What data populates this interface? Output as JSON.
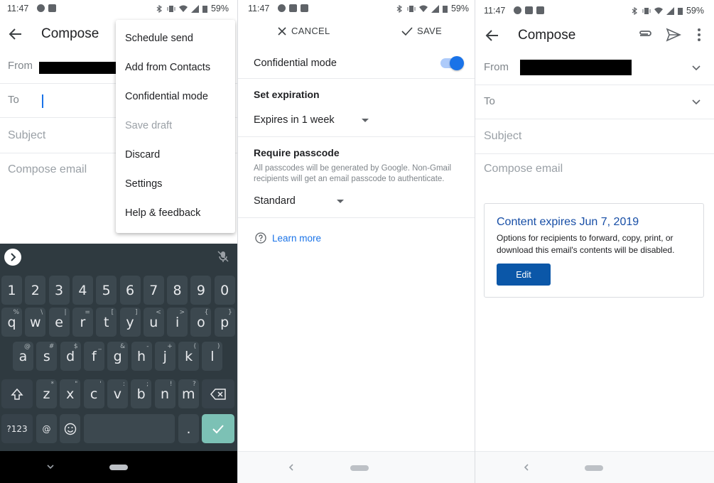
{
  "status": {
    "p1": {
      "time": "11:47",
      "battery": "59%"
    },
    "p2": {
      "time": "11:47",
      "battery": "59%"
    },
    "p3": {
      "time": "11:47",
      "battery": "59%"
    }
  },
  "compose_menu_screen": {
    "title": "Compose",
    "from_label": "From",
    "to_label": "To",
    "subject_placeholder": "Subject",
    "body_placeholder": "Compose email",
    "menu_items": [
      "Schedule send",
      "Add from Contacts",
      "Confidential mode",
      "Save draft",
      "Discard",
      "Settings",
      "Help & feedback"
    ],
    "disabled_menu_item": "Save draft",
    "keyboard": {
      "number_row": [
        "1",
        "2",
        "3",
        "4",
        "5",
        "6",
        "7",
        "8",
        "9",
        "0"
      ],
      "row1": [
        {
          "k": "q",
          "h": "%"
        },
        {
          "k": "w",
          "h": "\\"
        },
        {
          "k": "e",
          "h": "|"
        },
        {
          "k": "r",
          "h": "="
        },
        {
          "k": "t",
          "h": "["
        },
        {
          "k": "y",
          "h": "]"
        },
        {
          "k": "u",
          "h": "<"
        },
        {
          "k": "i",
          "h": ">"
        },
        {
          "k": "o",
          "h": "{"
        },
        {
          "k": "p",
          "h": "}"
        }
      ],
      "row2": [
        {
          "k": "a",
          "h": "@"
        },
        {
          "k": "s",
          "h": "#"
        },
        {
          "k": "d",
          "h": "$"
        },
        {
          "k": "f",
          "h": "_"
        },
        {
          "k": "g",
          "h": "&"
        },
        {
          "k": "h",
          "h": "-"
        },
        {
          "k": "j",
          "h": "+"
        },
        {
          "k": "k",
          "h": "("
        },
        {
          "k": "l",
          "h": ")"
        }
      ],
      "row3": [
        {
          "k": "z",
          "h": "*"
        },
        {
          "k": "x",
          "h": "\""
        },
        {
          "k": "c",
          "h": "'"
        },
        {
          "k": "v",
          "h": ":"
        },
        {
          "k": "b",
          "h": ";"
        },
        {
          "k": "n",
          "h": "!"
        },
        {
          "k": "m",
          "h": "?"
        }
      ],
      "symbols_key": "?123",
      "at_key": "@",
      "period_key": ".",
      "enter_color": "#7cc1b5"
    }
  },
  "confidential_screen": {
    "cancel_label": "CANCEL",
    "save_label": "SAVE",
    "confidential_label": "Confidential mode",
    "toggle_on": true,
    "set_expiration_heading": "Set expiration",
    "expiration_value": "Expires in 1 week",
    "passcode_heading": "Require passcode",
    "passcode_note": "All passcodes will be generated by Google. Non-Gmail recipients will get an email passcode to authenticate.",
    "passcode_value": "Standard",
    "learn_more": "Learn more",
    "accent_color": "#1a73e8"
  },
  "compose_result_screen": {
    "title": "Compose",
    "from_label": "From",
    "to_label": "To",
    "subject_placeholder": "Subject",
    "body_placeholder": "Compose email",
    "card_title": "Content expires Jun 7, 2019",
    "card_text": "Options for recipients to forward, copy, print, or download this email's contents will be disabled.",
    "edit_button": "Edit"
  }
}
